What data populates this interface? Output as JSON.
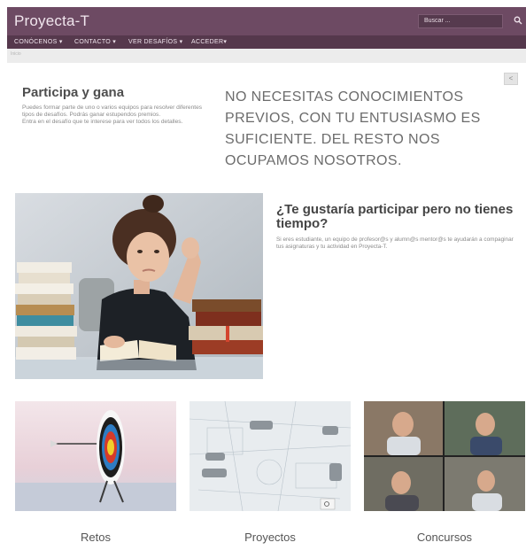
{
  "header": {
    "logo": "Proyecta-T",
    "search": {
      "placeholder": "Buscar ..."
    }
  },
  "nav": {
    "items": [
      {
        "label": "CONÓCENOS ▾"
      },
      {
        "label": "CONTACTO ▾"
      },
      {
        "label": "VER DESAFÍOS ▾"
      },
      {
        "label": "ACCEDER▾"
      }
    ]
  },
  "breadcrumb": "Inicio",
  "intro": {
    "title": "Participa y gana",
    "text": "Puedes formar parte de uno o varios equipos para resolver diferentes tipos de desafíos. Podrás ganar estupendos premios.",
    "text2": "Entra en el desafío que te interese para ver todos los detalles."
  },
  "headline": "NO NECESITAS CONOCIMIENTOS PREVIOS, CON TU ENTUSIASMO ES SUFICIENTE. DEL RESTO NOS OCUPAMOS NOSOTROS.",
  "time_section": {
    "title": "¿Te gustaría participar pero no tienes tiempo?",
    "text": "Si eres estudiante, un equipo de profesor@s y alumn@s mentor@s te ayudarán a compaginar tus asignaturas y tu actividad en Proyecta-T."
  },
  "cards": [
    {
      "caption": "Retos"
    },
    {
      "caption": "Proyectos"
    },
    {
      "caption": "Concursos"
    }
  ],
  "colors": {
    "brand": "#6d4a63",
    "nav": "#55384c"
  }
}
